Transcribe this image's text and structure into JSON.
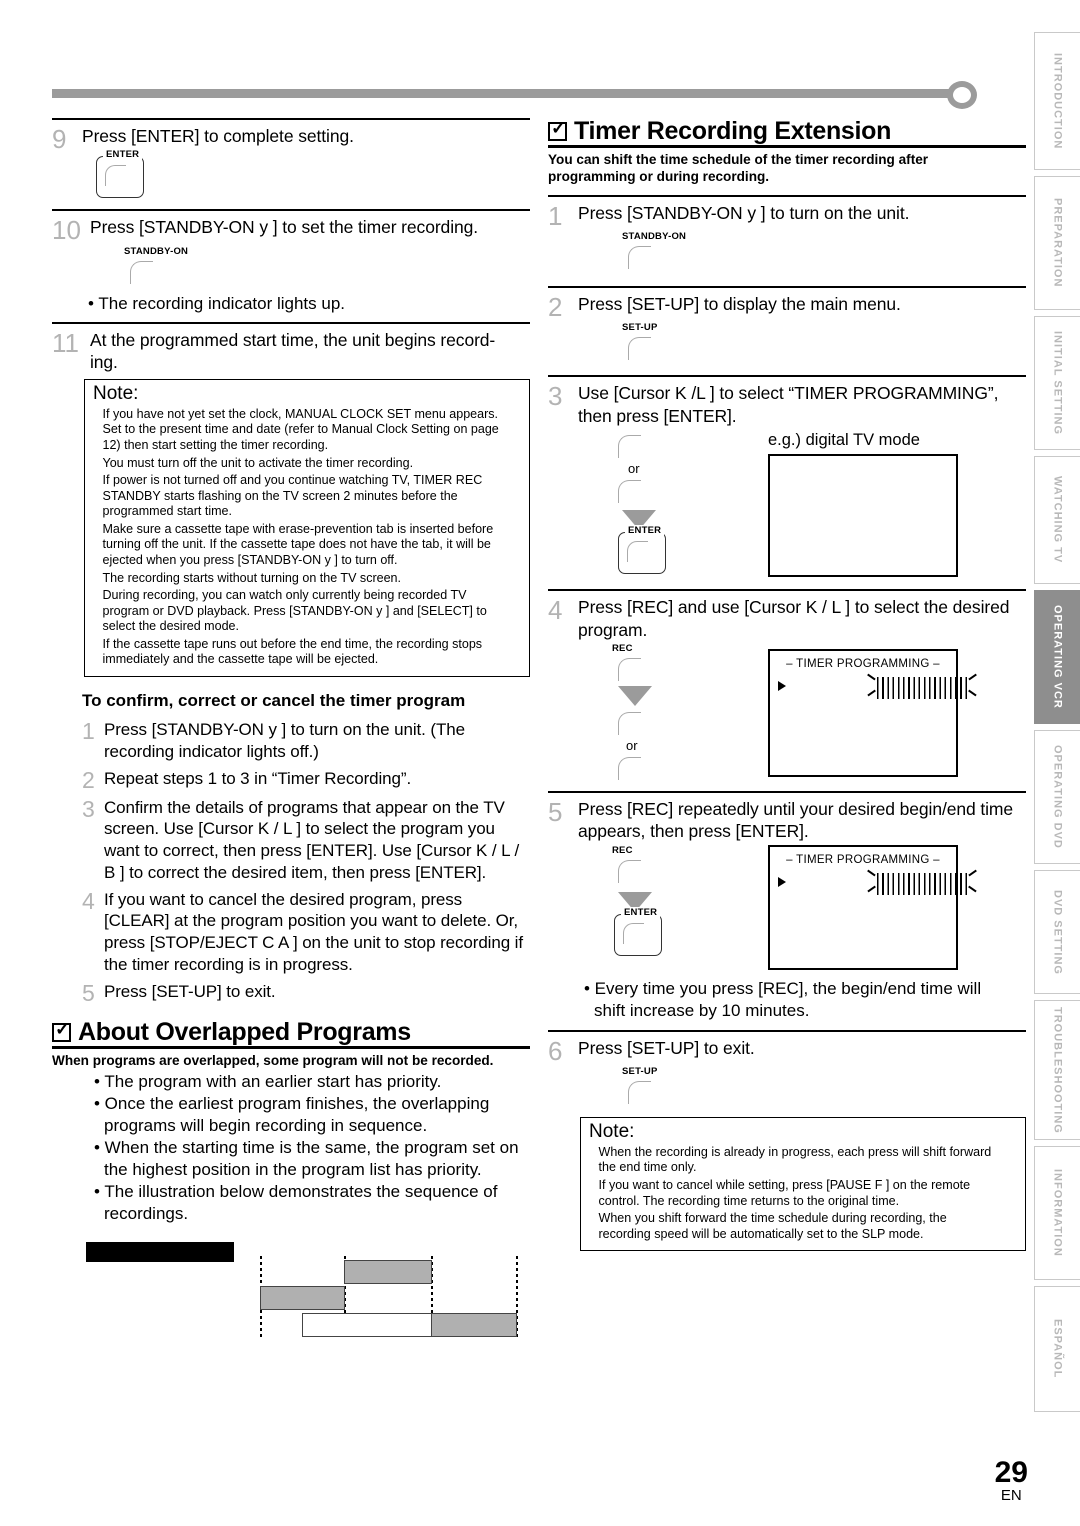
{
  "page": {
    "number": "29",
    "lang": "EN"
  },
  "left_column": {
    "step9": {
      "num": "9",
      "text": "Press [ENTER] to complete setting.",
      "key": {
        "label": "ENTER",
        "type": "boxed"
      }
    },
    "step10": {
      "num": "10",
      "text": "Press [STANDBY-ON y ] to set the timer recording.",
      "key": {
        "label": "STANDBY-ON",
        "type": "arc"
      },
      "bullet": "• The recording indicator lights up."
    },
    "step11": {
      "num": "11",
      "text": "At the programmed start time, the unit begins record- ing."
    },
    "note": {
      "title": "Note:",
      "items": [
        "If you have not yet set the clock,  MANUAL CLOCK SET  menu appears. Set to the present time and date (refer to  Manual Clock Setting  on page 12) then start setting the timer recording.",
        "You must turn off the unit to activate the timer recording.",
        "If power is not turned off and you continue watching TV,  TIMER REC STANDBY  starts flashing on the TV screen 2 minutes before the programmed start time.",
        "Make sure a cassette tape with erase-prevention tab is inserted before turning off the unit. If the cassette tape does not have the tab, it will be ejected when you press [STANDBY-ON y ] to turn off.",
        "The recording starts without turning on the TV screen.",
        "During recording, you can watch only currently being recorded TV program or DVD playback. Press [STANDBY-ON y ] and [SELECT] to select the desired mode.",
        "If the cassette tape runs out before the end time, the recording stops immediately and the cassette tape will be ejected."
      ]
    },
    "confirm_heading": "To confirm, correct or cancel the timer program",
    "confirm_steps": [
      {
        "num": "1",
        "text": "Press [STANDBY-ON y ] to turn on the unit. (The recording indicator lights off.)"
      },
      {
        "num": "2",
        "text": "Repeat steps 1 to 3 in “Timer Recording”."
      },
      {
        "num": "3",
        "text": "Confirm the details of programs that appear on the TV screen. Use [Cursor K / L ] to select the program you want to correct, then press [ENTER]. Use [Cursor K / L  / B ] to correct the desired item, then press [ENTER]."
      },
      {
        "num": "4",
        "text": "If you want to cancel the desired program, press [CLEAR] at the program position you want to delete. Or, press [STOP/EJECT C A ] on the unit to stop recording if the timer recording is in progress."
      },
      {
        "num": "5",
        "text": "Press [SET-UP] to exit."
      }
    ],
    "overlapped": {
      "title": "About Overlapped Programs",
      "subtitle": "When programs are overlapped, some program will not be recorded.",
      "bullets": [
        "• The program with an earlier start has priority.",
        "• Once the earliest program finishes, the overlapping programs will begin recording in sequence.",
        "• When the starting time is the same, the program set on the highest position in the program list has priority.",
        "• The illustration below demonstrates the sequence of recordings."
      ]
    }
  },
  "right_column": {
    "section": {
      "title": "Timer Recording Extension",
      "subtitle": "You can shift the time schedule of the timer recording after programming or during recording."
    },
    "steps": [
      {
        "num": "1",
        "text": "Press [STANDBY-ON y ] to turn on the unit.",
        "key": {
          "label": "STANDBY-ON",
          "type": "arc"
        }
      },
      {
        "num": "2",
        "text": "Press [SET-UP] to display the main menu.",
        "key": {
          "label": "SET-UP",
          "type": "arc"
        }
      },
      {
        "num": "3",
        "text": "Use [Cursor K /L ] to select “TIMER PROGRAMMING”, then press [ENTER].",
        "or_label": "or",
        "enter_label": "ENTER",
        "screen_caption": "e.g.) digital TV mode",
        "screen_title": ""
      },
      {
        "num": "4",
        "text": "Press [REC] and use [Cursor K / L ] to select the desired program.",
        "key_label": "REC",
        "or_label": "or",
        "screen_title": "– TIMER PROGRAMMING –"
      },
      {
        "num": "5",
        "text": "Press [REC] repeatedly until your desired begin/end time appears, then press [ENTER].",
        "key_label": "REC",
        "enter_label": "ENTER",
        "screen_title": "– TIMER PROGRAMMING –",
        "bullet": "• Every time you press [REC], the begin/end time will shift increase by 10 minutes."
      },
      {
        "num": "6",
        "text": "Press [SET-UP] to exit.",
        "key": {
          "label": "SET-UP",
          "type": "arc"
        }
      }
    ],
    "note": {
      "title": "Note:",
      "items": [
        "When the recording is already in progress, each press will shift forward the end time only.",
        "If you want to cancel while setting, press [PAUSE F ] on the remote control. The recording time returns to the original time.",
        "When you shift forward the time schedule during recording, the recording speed will be automatically set to the SLP mode."
      ]
    }
  },
  "side_tabs": [
    {
      "label": "INTRODUCTION",
      "active": false
    },
    {
      "label": "PREPARATION",
      "active": false
    },
    {
      "label": "INITIAL  SETTING",
      "active": false
    },
    {
      "label": "WATCHING  TV",
      "active": false
    },
    {
      "label": "OPERATING  VCR",
      "active": true
    },
    {
      "label": "OPERATING  DVD",
      "active": false
    },
    {
      "label": "DVD  SETTING",
      "active": false
    },
    {
      "label": "TROUBLESHOOTING",
      "active": false
    },
    {
      "label": "INFORMATION",
      "active": false
    },
    {
      "label": "ESPAÑOL",
      "active": false
    }
  ],
  "colors": {
    "step_number": "#b3b3b3",
    "deco_bar": "#9b9b9b",
    "active_tab": "#8e8e8e",
    "diagram_gray": "#b0b0b0"
  }
}
